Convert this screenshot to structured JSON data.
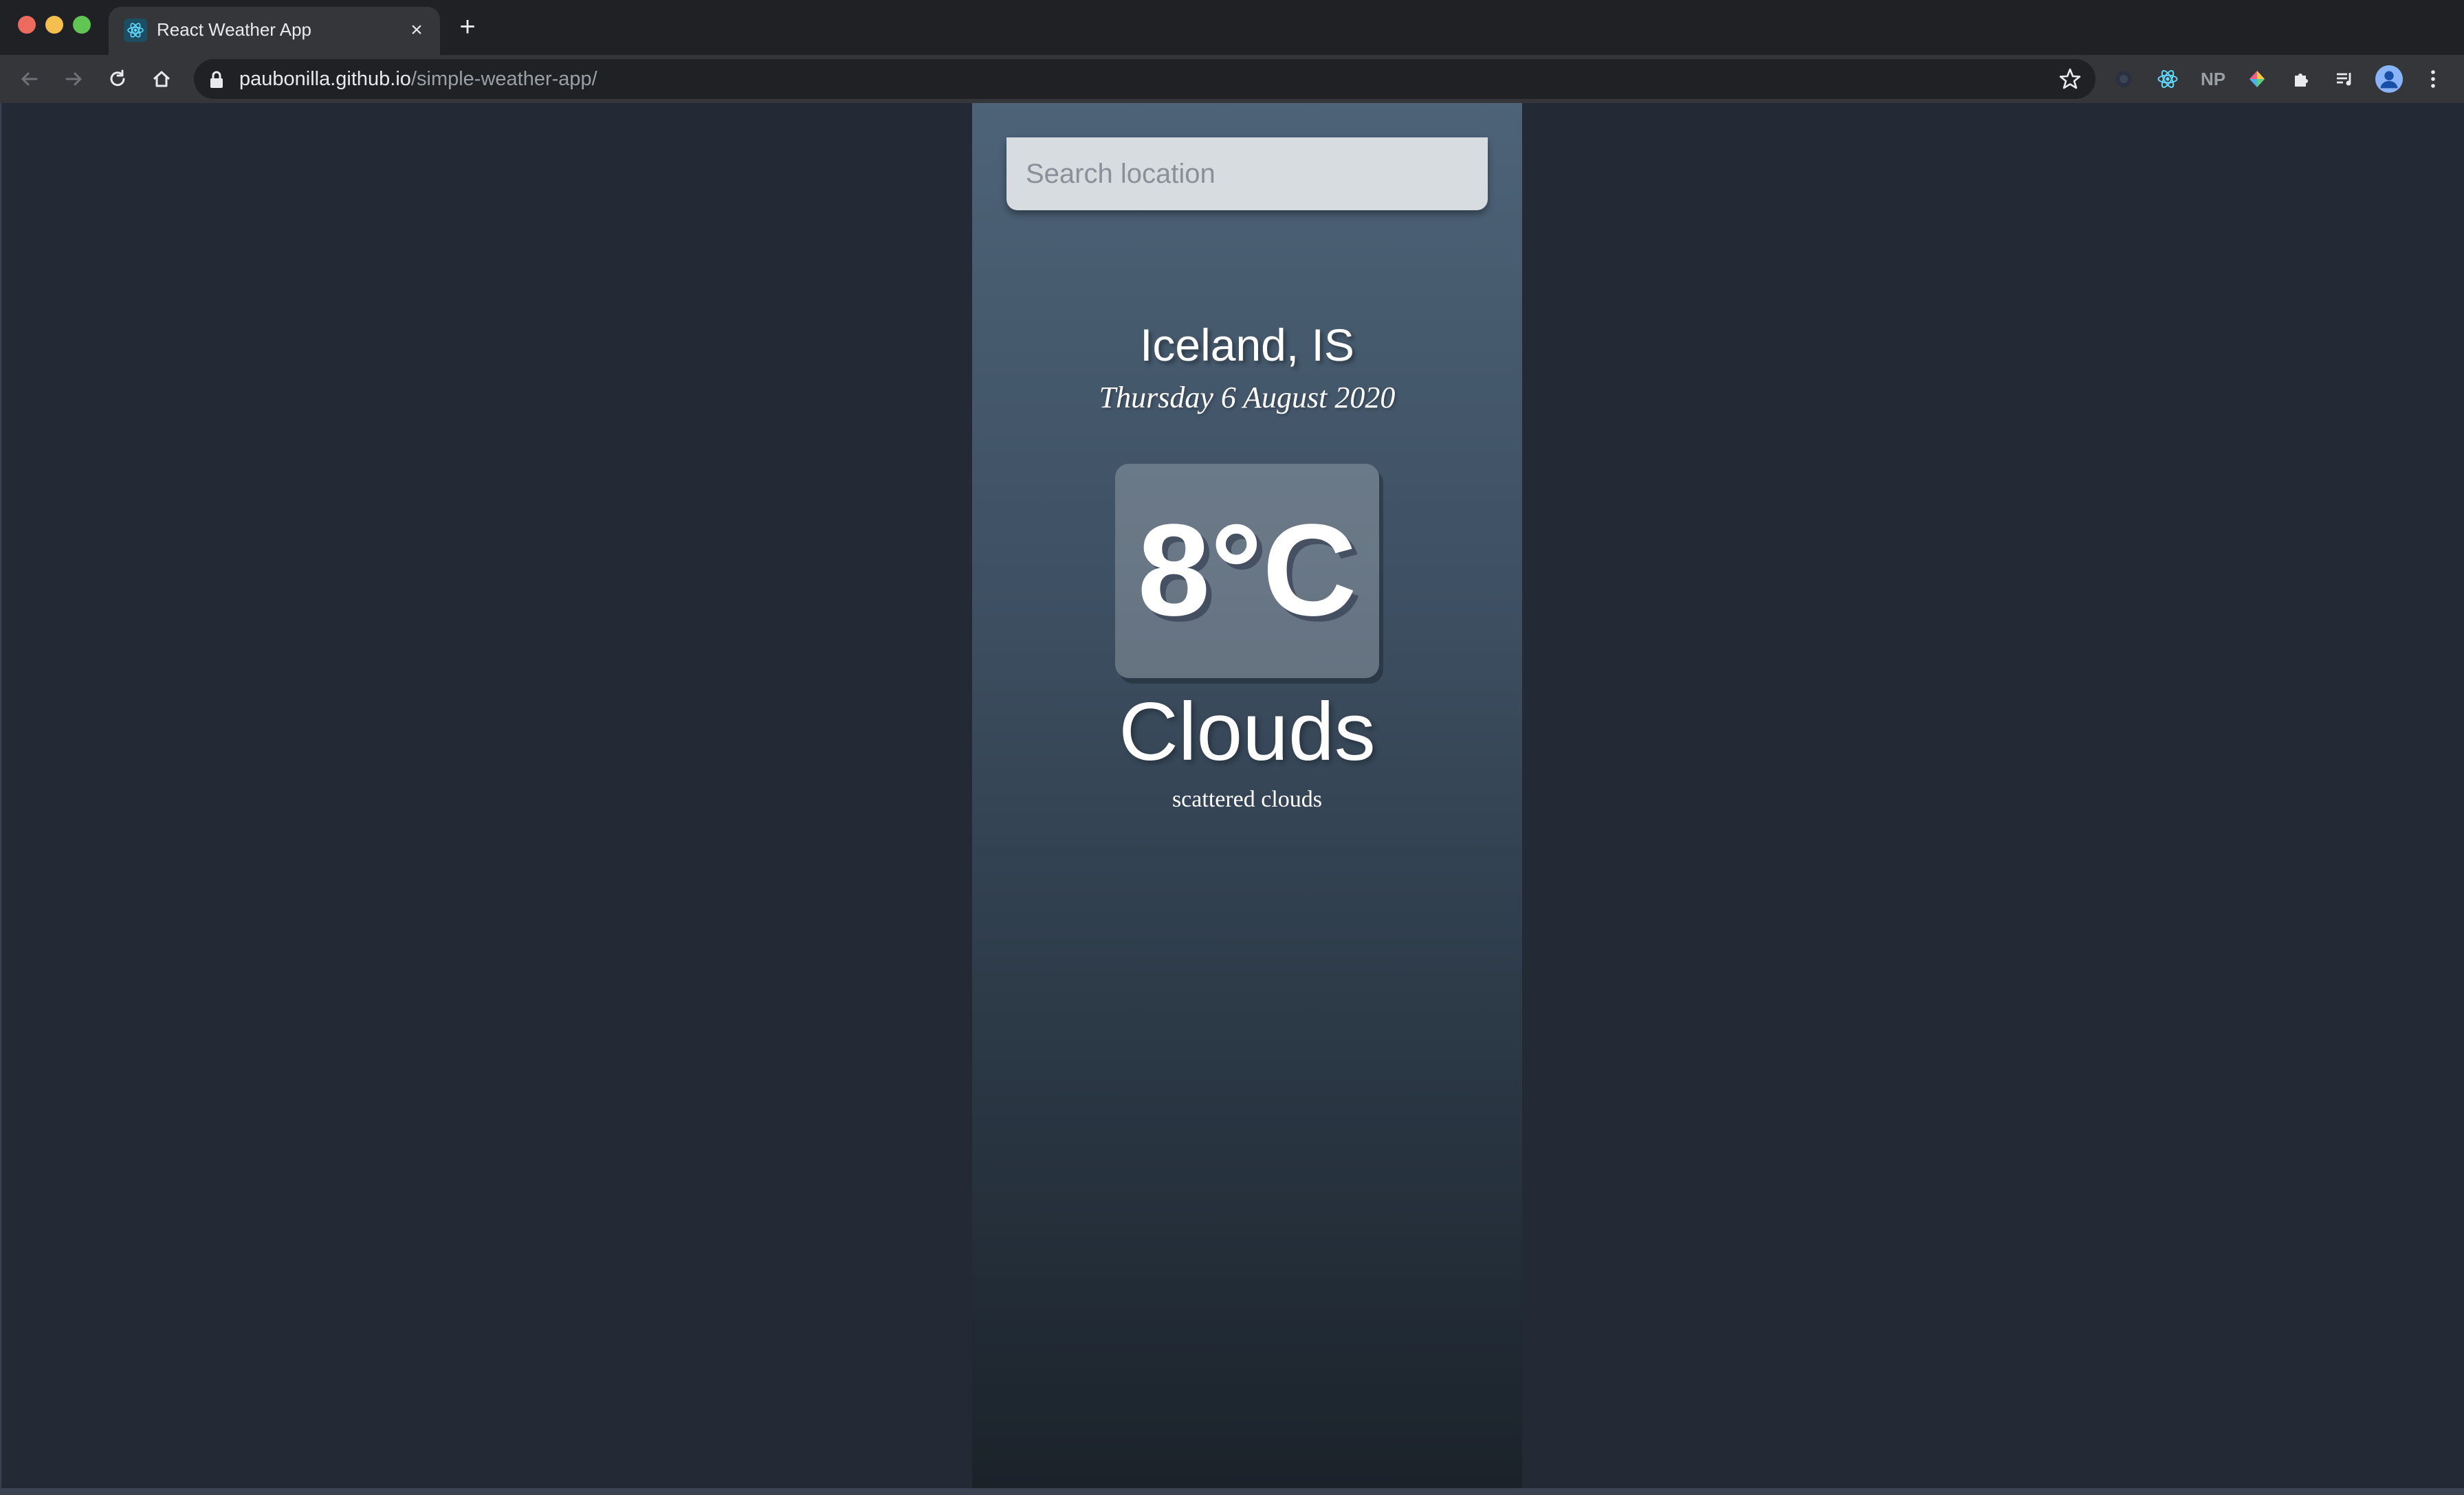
{
  "browser": {
    "tab": {
      "title": "React Weather App",
      "close": "×"
    },
    "new_tab": "+",
    "url": {
      "host": "paubonilla.github.io",
      "path": "/simple-weather-app/"
    },
    "extensions": [
      {
        "icon": "dark-mode-extension-icon"
      },
      {
        "icon": "react-devtools-icon"
      },
      {
        "icon": "np-extension-icon",
        "label": "NP"
      },
      {
        "icon": "color-picker-extension-icon"
      },
      {
        "icon": "puzzle-extensions-icon"
      },
      {
        "icon": "media-queue-icon"
      },
      {
        "icon": "profile-avatar-icon"
      },
      {
        "icon": "kebab-menu-icon"
      }
    ]
  },
  "app": {
    "search": {
      "placeholder": "Search location",
      "value": ""
    },
    "location": "Iceland, IS",
    "date": "Thursday 6 August 2020",
    "temperature": "8°C",
    "weather": "Clouds",
    "description": "scattered clouds"
  },
  "colors": {
    "page_background": "#232a36",
    "app_gradient_top": "#4d6377",
    "app_gradient_bottom": "#1b222a"
  }
}
